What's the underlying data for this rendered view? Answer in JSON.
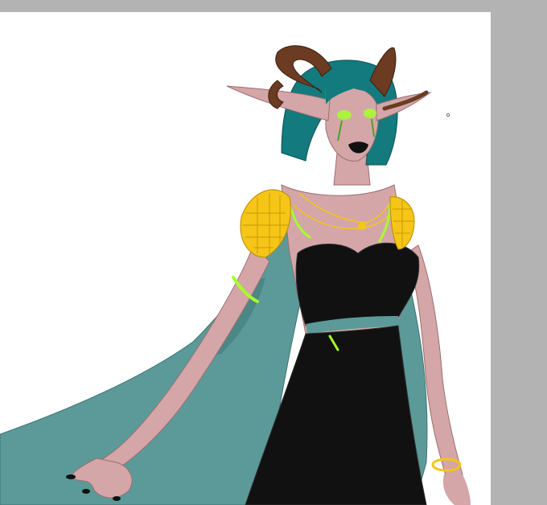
{
  "app": {
    "view": "drawing canvas",
    "colors": {
      "workspace_background": "#b3b3b3",
      "canvas_background": "#ffffff"
    }
  },
  "artwork": {
    "subject_icon": "horned-elf-woman-illustration",
    "palette": {
      "skin": "#d4a6a8",
      "hair": "#137a7e",
      "horn": "#6b3b22",
      "cape": "#5b9a98",
      "dress": "#111111",
      "gold": "#f5c518",
      "glow": "#a6ff2a"
    }
  }
}
